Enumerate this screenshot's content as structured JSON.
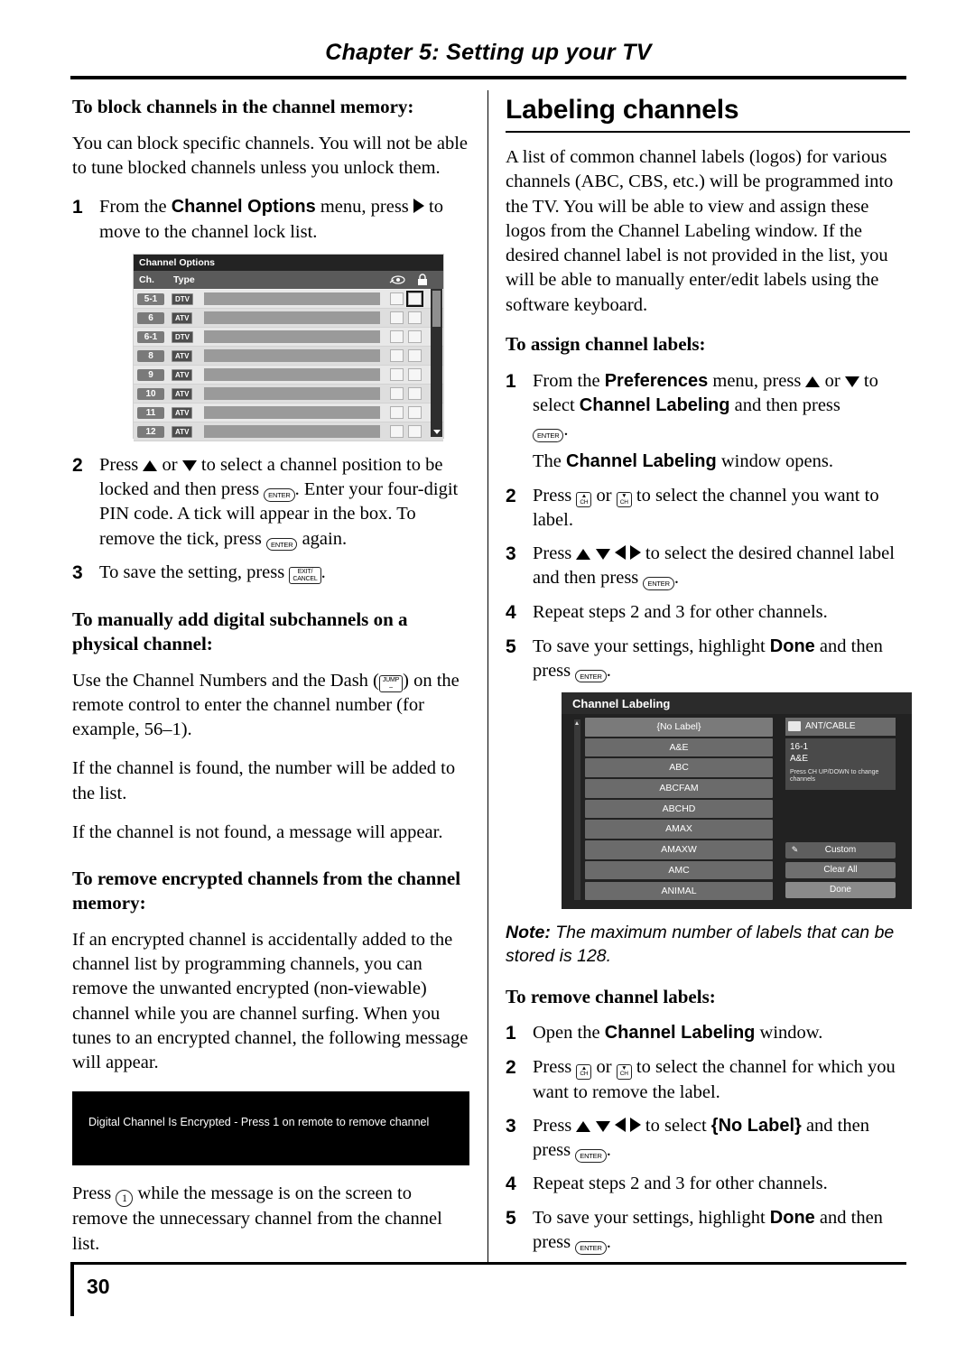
{
  "header": {
    "chapter": "Chapter 5: Setting up your TV"
  },
  "footer": {
    "page_number": "30"
  },
  "left": {
    "h_block": "To block channels in the channel memory:",
    "p_block": "You can block specific channels. You will not be able to tune blocked channels unless you unlock them.",
    "step1_a": "From the ",
    "step1_bold": "Channel Options",
    "step1_b": " menu, press ",
    "step1_c": " to move to the channel lock list.",
    "step1_num": "1",
    "step2_num": "2",
    "step2_a": "Press ",
    "step2_b": " or ",
    "step2_c": " to select a channel position to be locked and then press ",
    "step2_d": ". Enter your four-digit PIN code. A tick will appear in the box. To remove the tick, press ",
    "step2_e": " again.",
    "step3_num": "3",
    "step3_a": "To save the setting, press ",
    "step3_b": ".",
    "h_manual": "To manually add digital subchannels on a physical channel:",
    "p_manual_1a": "Use the Channel Numbers and the Dash (",
    "p_manual_1b": ") on the remote control to enter the channel number (for example, 56–1).",
    "p_manual_2": "If the channel is found, the number will be added to the list.",
    "p_manual_3": "If the channel is not found, a message will appear.",
    "h_remove_enc": "To remove encrypted channels from the channel memory:",
    "p_remove_enc": "If an encrypted channel is accidentally added to the channel list by programming channels, you can remove the unwanted encrypted (non-viewable) channel while you are channel surfing. When you tunes to an encrypted channel, the following message will appear.",
    "banner_text": "Digital Channel Is Encrypted - Press 1 on remote to remove channel",
    "p_press_1a": "Press ",
    "p_press_1b": " while the message is on the screen to remove the unnecessary channel from the channel list.",
    "channel_options": {
      "window_title": "Channel Options",
      "col_ch": "Ch.",
      "col_type": "Type",
      "rows": [
        {
          "num": "5-1",
          "type": "DTV"
        },
        {
          "num": "6",
          "type": "ATV"
        },
        {
          "num": "6-1",
          "type": "DTV"
        },
        {
          "num": "8",
          "type": "ATV"
        },
        {
          "num": "9",
          "type": "ATV"
        },
        {
          "num": "10",
          "type": "ATV"
        },
        {
          "num": "11",
          "type": "ATV"
        },
        {
          "num": "12",
          "type": "ATV"
        }
      ]
    }
  },
  "right": {
    "title": "Labeling channels",
    "p_intro": "A list of common channel labels (logos) for various channels (ABC, CBS, etc.) will be programmed into the TV. You will be able to view and assign these logos from the Channel Labeling window. If the desired channel label is not provided in the list, you will be able to manually enter/edit labels using the software keyboard.",
    "h_assign": "To assign channel labels:",
    "assign_step1_num": "1",
    "assign_step1_a": "From the ",
    "assign_step1_pref": "Preferences",
    "assign_step1_b": " menu, press ",
    "assign_step1_c": " or ",
    "assign_step1_d": " to select ",
    "assign_step1_cl": "Channel Labeling",
    "assign_step1_e": " and then press ",
    "assign_step1_f": ".",
    "assign_step1_note_a": "The ",
    "assign_step1_note_bold": "Channel Labeling",
    "assign_step1_note_b": " window opens.",
    "assign_step2_num": "2",
    "assign_step2_a": "Press ",
    "assign_step2_b": " or ",
    "assign_step2_c": " to select the channel you want to label.",
    "assign_step3_num": "3",
    "assign_step3_a": "Press ",
    "assign_step3_b": " to select the desired channel label and then press ",
    "assign_step3_c": ".",
    "assign_step4_num": "4",
    "assign_step4": "Repeat steps 2 and 3 for other channels.",
    "assign_step5_num": "5",
    "assign_step5_a": "To save your settings, highlight ",
    "assign_step5_done": "Done",
    "assign_step5_b": " and then press ",
    "assign_step5_c": ".",
    "note_a": "Note: ",
    "note_b": "The maximum number of labels that can be stored is 128.",
    "h_remove": "To remove channel labels:",
    "remove_step1_num": "1",
    "remove_step1_a": "Open the ",
    "remove_step1_bold": "Channel Labeling",
    "remove_step1_b": " window.",
    "remove_step2_num": "2",
    "remove_step2_a": "Press ",
    "remove_step2_b": " or ",
    "remove_step2_c": " to select the channel for which you want to remove the label.",
    "remove_step3_num": "3",
    "remove_step3_a": "Press ",
    "remove_step3_b": " to select ",
    "remove_step3_nolabel": "{No Label}",
    "remove_step3_c": " and then press ",
    "remove_step3_d": ".",
    "remove_step4_num": "4",
    "remove_step4": "Repeat steps 2 and 3 for other channels.",
    "remove_step5_num": "5",
    "remove_step5_a": "To save your settings, highlight ",
    "remove_step5_done": "Done",
    "remove_step5_b": " and then press ",
    "remove_step5_c": ".",
    "channel_labeling": {
      "window_title": "Channel  Labeling",
      "labels": [
        "{No Label}",
        "A&E",
        "ABC",
        "ABCFAM",
        "ABCHD",
        "AMAX",
        "AMAXW",
        "AMC",
        "ANIMAL"
      ],
      "source": "ANT/CABLE",
      "current_channel": "16-1",
      "current_label": "A&E",
      "hint": "Press CH UP/DOWN to change channels",
      "btn_custom": "Custom",
      "btn_clear_all": "Clear All",
      "btn_done": "Done"
    }
  },
  "keys": {
    "enter": "ENTER",
    "exit_cancel_l1": "EXIT/",
    "exit_cancel_l2": "CANCEL",
    "jump_l1": "JUMP",
    "ch_up": "CH",
    "ch_down": "CH",
    "one": "1"
  }
}
